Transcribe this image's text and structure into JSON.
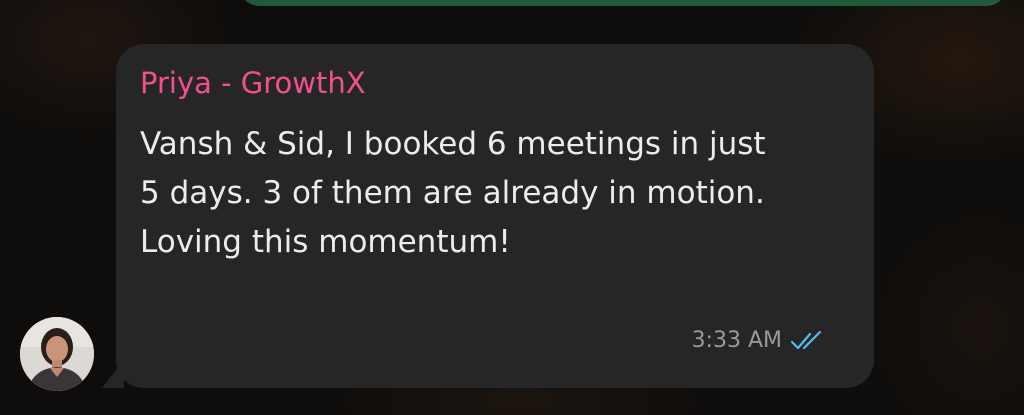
{
  "message": {
    "sender": "Priya - GrowthX",
    "lines": [
      "Vansh & Sid, I booked 6 meetings in just",
      "5 days. 3 of them are already in motion.",
      "Loving this momentum!"
    ],
    "time": "3:33 AM",
    "status_icon": "double-check-read-icon"
  },
  "colors": {
    "sender_name": "#f0508e",
    "bubble": "#262626",
    "read_ticks": "#53bdeb",
    "outgoing_bubble": "#1f5a3a"
  }
}
